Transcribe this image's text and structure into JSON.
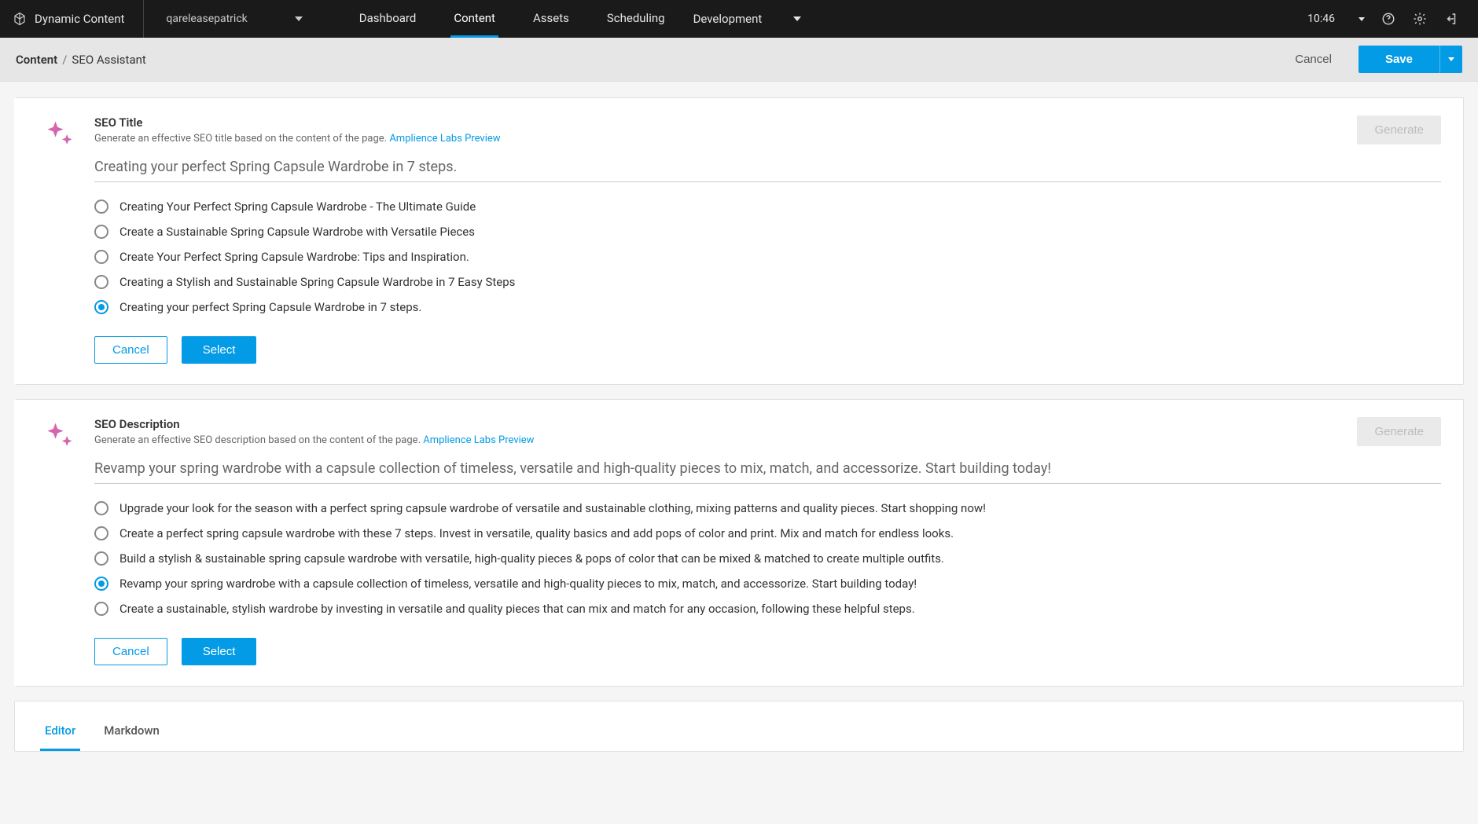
{
  "topnav": {
    "brand": "Dynamic Content",
    "workspace": "qareleasepatrick",
    "links": {
      "dashboard": "Dashboard",
      "content": "Content",
      "assets": "Assets",
      "scheduling": "Scheduling"
    },
    "development": "Development",
    "time": "10:46"
  },
  "actionbar": {
    "crumb_root": "Content",
    "crumb_current": "SEO Assistant",
    "crumb_sep": "/",
    "cancel": "Cancel",
    "save": "Save"
  },
  "seo_title": {
    "heading": "SEO Title",
    "subtitle_prefix": "Generate an effective SEO title based on the content of the page. ",
    "subtitle_link": "Amplience Labs Preview",
    "generate": "Generate",
    "current_value": "Creating your perfect Spring Capsule Wardrobe in 7 steps.",
    "options": [
      "Creating Your Perfect Spring Capsule Wardrobe - The Ultimate Guide",
      "Create a Sustainable Spring Capsule Wardrobe with Versatile Pieces",
      "Create Your Perfect Spring Capsule Wardrobe: Tips and Inspiration.",
      "Creating a Stylish and Sustainable Spring Capsule Wardrobe in 7 Easy Steps",
      "Creating your perfect Spring Capsule Wardrobe in 7 steps."
    ],
    "selected_index": 4,
    "cancel": "Cancel",
    "select": "Select"
  },
  "seo_description": {
    "heading": "SEO Description",
    "subtitle_prefix": "Generate an effective SEO description based on the content of the page. ",
    "subtitle_link": "Amplience Labs Preview",
    "generate": "Generate",
    "current_value": "Revamp your spring wardrobe with a capsule collection of timeless, versatile and high-quality pieces to mix, match, and accessorize. Start building today!",
    "options": [
      "Upgrade your look for the season with a perfect spring capsule wardrobe of versatile and sustainable clothing, mixing patterns and quality pieces. Start shopping now!",
      "Create a perfect spring capsule wardrobe with these 7 steps. Invest in versatile, quality basics and add pops of color and print. Mix and match for endless looks.",
      "Build a stylish & sustainable spring capsule wardrobe with versatile, high-quality pieces & pops of color that can be mixed & matched to create multiple outfits.",
      "Revamp your spring wardrobe with a capsule collection of timeless, versatile and high-quality pieces to mix, match, and accessorize. Start building today!",
      "Create a sustainable, stylish wardrobe by investing in versatile and quality pieces that can mix and match for any occasion, following these helpful steps."
    ],
    "selected_index": 3,
    "cancel": "Cancel",
    "select": "Select"
  },
  "editor": {
    "tabs": {
      "editor": "Editor",
      "markdown": "Markdown"
    }
  }
}
